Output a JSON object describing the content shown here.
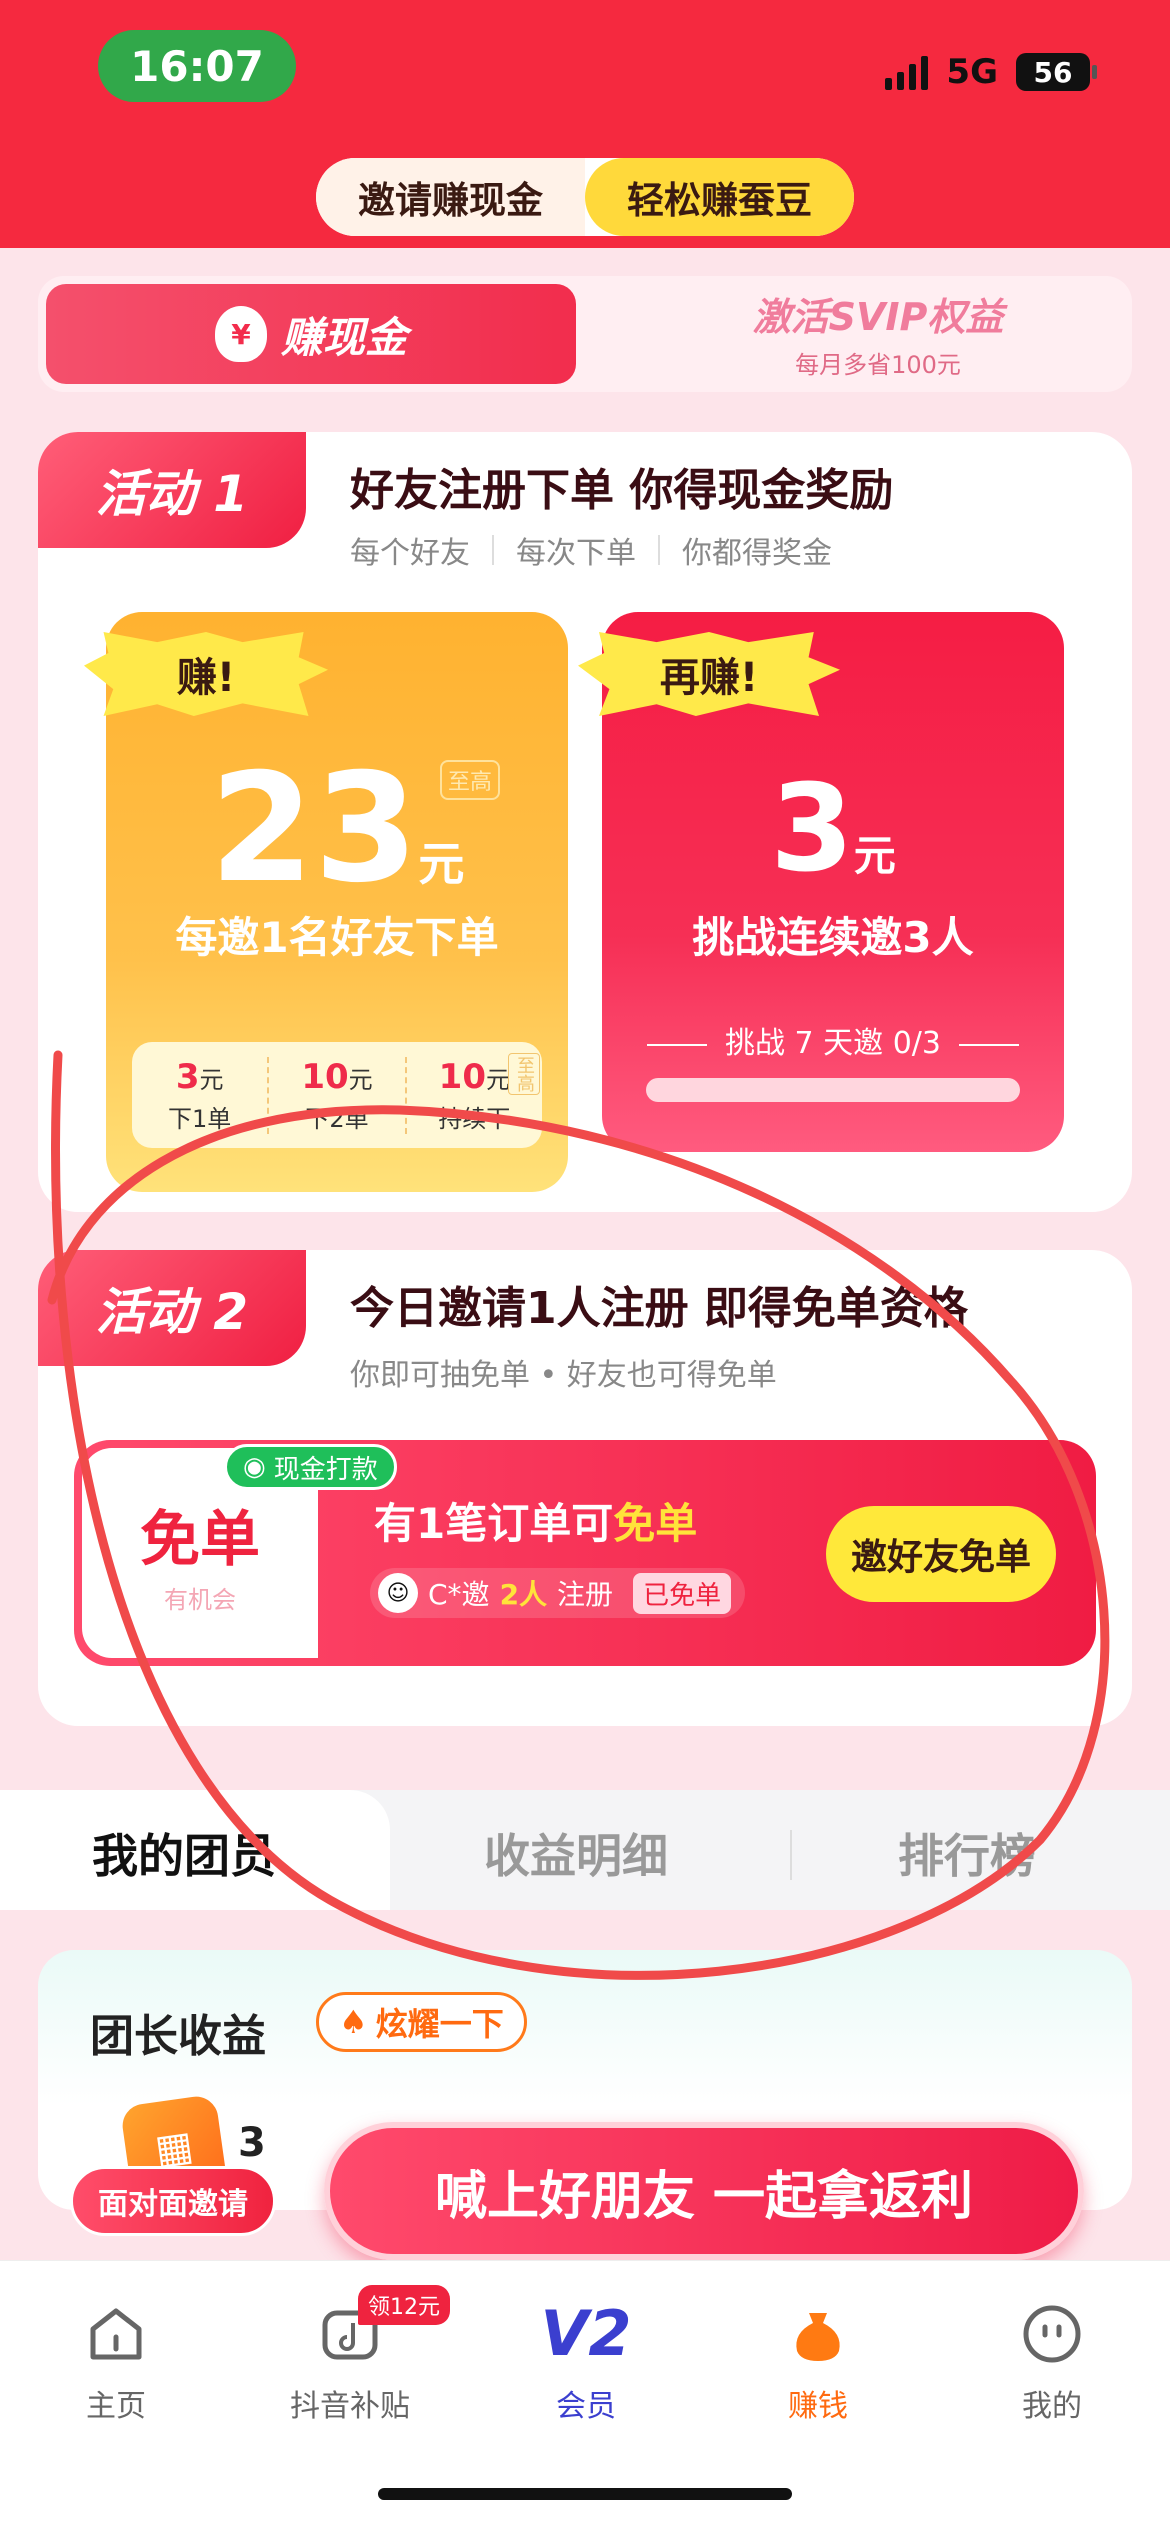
{
  "status": {
    "time": "16:07",
    "network": "5G",
    "battery": "56"
  },
  "top_tabs": [
    {
      "label": "邀请赚现金"
    },
    {
      "label": "轻松赚蚕豆"
    }
  ],
  "earn_switch": {
    "active_icon": "¥",
    "active_label": "赚现金",
    "right_title": "激活SVIP权益",
    "right_sub": "每月多省100元"
  },
  "activity1": {
    "badge": "活动 1",
    "title": "好友注册下单 你得现金奖励",
    "sub": [
      "每个好友",
      "每次下单",
      "你都得奖金"
    ],
    "card_left": {
      "burst": "赚!",
      "amount": "23",
      "unit": "元",
      "tag": "至高",
      "desc": "每邀1名好友下单",
      "tiers": [
        {
          "value": "3",
          "unit": "元",
          "label": "下1单"
        },
        {
          "value": "10",
          "unit": "元",
          "label": "下2单"
        },
        {
          "value": "10",
          "unit": "元",
          "label": "持续下"
        }
      ],
      "tier_tag": "至高"
    },
    "card_right": {
      "burst": "再赚!",
      "amount": "3",
      "unit": "元",
      "desc": "挑战连续邀3人",
      "challenge": "挑战 7 天邀 0/3",
      "progress": 0
    }
  },
  "activity2": {
    "badge": "活动 2",
    "title": "今日邀请1人注册 即得免单资格",
    "sub": "你即可抽免单 • 好友也可得免单",
    "banner": {
      "cash_tag": "现金打款",
      "free_label": "免单",
      "free_sub": "有机会",
      "title_prefix": "有1笔订单可",
      "title_highlight": "免单",
      "info_user": "C*邀",
      "info_count": "2人",
      "info_suffix": "注册",
      "done_tag": "已免单",
      "button": "邀好友免单"
    }
  },
  "lower_tabs": [
    {
      "label": "我的团员"
    },
    {
      "label": "收益明细"
    },
    {
      "label": "排行榜"
    }
  ],
  "earnings": {
    "title": "团长收益",
    "show_button": "炫耀一下",
    "value": "3"
  },
  "promo": {
    "f2f_label": "面对面邀请",
    "cta": "喊上好朋友 一起拿返利"
  },
  "bottom_nav": [
    {
      "label": "主页",
      "icon": "home-icon"
    },
    {
      "label": "抖音补贴",
      "icon": "douyin-icon",
      "badge": "领12元"
    },
    {
      "label": "会员",
      "icon": "v2-icon",
      "icon_text": "V2"
    },
    {
      "label": "赚钱",
      "icon": "money-bag-icon"
    },
    {
      "label": "我的",
      "icon": "profile-icon"
    }
  ],
  "colors": {
    "brand_red": "#f5293f",
    "accent_yellow": "#ffe83a",
    "annotation": "#f04a4a"
  }
}
